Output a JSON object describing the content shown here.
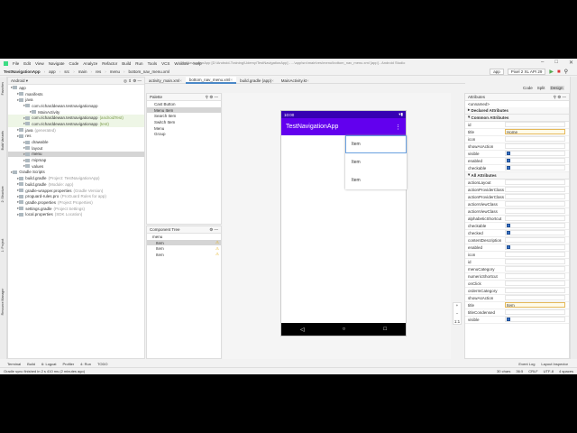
{
  "window": {
    "title": "TestNavigationApp [D:\\Android-Training\\Udemy\\TestNavigationApp] - ...\\app\\src\\main\\res\\menu\\bottom_nav_menu.xml [app] - Android Studio"
  },
  "menu": [
    "File",
    "Edit",
    "View",
    "Navigate",
    "Code",
    "Analyze",
    "Refactor",
    "Build",
    "Run",
    "Tools",
    "VCS",
    "Window",
    "Help"
  ],
  "breadcrumb": [
    "TestNavigationApp",
    "app",
    "src",
    "main",
    "res",
    "menu",
    "bottom_nav_menu.xml"
  ],
  "toolbar": {
    "run_config": "app",
    "device": "Pixel 2 XL API 29"
  },
  "project": {
    "view": "Android",
    "tree": [
      {
        "label": "app",
        "indent": 0
      },
      {
        "label": "manifests",
        "indent": 1
      },
      {
        "label": "java",
        "indent": 1
      },
      {
        "label": "com.richarddewan.testnavigationapp",
        "indent": 2
      },
      {
        "label": "MainActivity",
        "indent": 3
      },
      {
        "label": "com.richarddewan.testnavigationapp",
        "note": "(androidTest)",
        "indent": 2,
        "green": true
      },
      {
        "label": "com.richarddewan.testnavigationapp",
        "note": "(test)",
        "indent": 2,
        "green": true
      },
      {
        "label": "java",
        "note": "(generated)",
        "indent": 1
      },
      {
        "label": "res",
        "indent": 1
      },
      {
        "label": "drawable",
        "indent": 2
      },
      {
        "label": "layout",
        "indent": 2
      },
      {
        "label": "menu",
        "indent": 2,
        "selected": true
      },
      {
        "label": "mipmap",
        "indent": 2
      },
      {
        "label": "values",
        "indent": 2
      },
      {
        "label": "Gradle Scripts",
        "indent": 0
      },
      {
        "label": "build.gradle",
        "note": "(Project: TestNavigationApp)",
        "indent": 1
      },
      {
        "label": "build.gradle",
        "note": "(Module: app)",
        "indent": 1
      },
      {
        "label": "gradle-wrapper.properties",
        "note": "(Gradle Version)",
        "indent": 1
      },
      {
        "label": "proguard-rules.pro",
        "note": "(ProGuard Rules for app)",
        "indent": 1
      },
      {
        "label": "gradle.properties",
        "note": "(Project Properties)",
        "indent": 1
      },
      {
        "label": "settings.gradle",
        "note": "(Project Settings)",
        "indent": 1
      },
      {
        "label": "local.properties",
        "note": "(SDK Location)",
        "indent": 1
      }
    ]
  },
  "side_left": [
    "Resource Manager",
    "1: Project",
    "2: Structure",
    "Build Variants",
    "Favorites"
  ],
  "editor_tabs": [
    "activity_main.xml",
    "bottom_nav_menu.xml",
    "build.gradle (app)",
    "MainActivity.kt"
  ],
  "view_modes": [
    "Code",
    "Split",
    "Design"
  ],
  "palette": {
    "title": "Palette",
    "items": [
      "Cast Button",
      "Menu Item",
      "Search Item",
      "Switch Item",
      "Menu",
      "Group"
    ]
  },
  "component_tree": {
    "title": "Component Tree",
    "root": "menu",
    "items": [
      "Item",
      "Item",
      "Item"
    ]
  },
  "phone": {
    "time": "10:00",
    "app_title": "TestNavigationApp",
    "items": [
      "Item",
      "Item",
      "Item"
    ],
    "appbar_color": "#6200ee",
    "status_color": "#3700b3"
  },
  "zoom_controls": [
    "+",
    "−",
    "1:1"
  ],
  "attributes": {
    "title": "Attributes",
    "component": "<unnamed>",
    "declared": "Declared Attributes",
    "common": "Common Attributes",
    "common_rows": [
      {
        "k": "id",
        "v": ""
      },
      {
        "k": "title",
        "v": "Home"
      },
      {
        "k": "icon",
        "v": ""
      },
      {
        "k": "showAsAction",
        "v": ""
      },
      {
        "k": "visible",
        "v": ""
      },
      {
        "k": "enabled",
        "v": ""
      },
      {
        "k": "checkable",
        "v": ""
      }
    ],
    "all": "All Attributes",
    "all_rows": [
      {
        "k": "actionLayout",
        "v": ""
      },
      {
        "k": "actionProviderClass",
        "v": ""
      },
      {
        "k": "actionProviderClass",
        "v": ""
      },
      {
        "k": "actionViewClass",
        "v": ""
      },
      {
        "k": "actionViewClass",
        "v": ""
      },
      {
        "k": "alphabeticShortcut",
        "v": ""
      },
      {
        "k": "checkable",
        "v": ""
      },
      {
        "k": "checked",
        "v": ""
      },
      {
        "k": "contentDescription",
        "v": ""
      },
      {
        "k": "enabled",
        "v": ""
      },
      {
        "k": "icon",
        "v": ""
      },
      {
        "k": "id",
        "v": ""
      },
      {
        "k": "menuCategory",
        "v": ""
      },
      {
        "k": "numericShortcut",
        "v": ""
      },
      {
        "k": "onClick",
        "v": ""
      },
      {
        "k": "orderInCategory",
        "v": ""
      },
      {
        "k": "showAsAction",
        "v": ""
      },
      {
        "k": "title",
        "v": "Item"
      },
      {
        "k": "titleCondensed",
        "v": ""
      },
      {
        "k": "visible",
        "v": ""
      }
    ]
  },
  "bottom_tools": [
    "Terminal",
    "Build",
    "6: Logcat",
    "Profiler",
    "4: Run",
    "TODO"
  ],
  "bottom_right_tools": [
    "Event Log",
    "Layout Inspector"
  ],
  "status": {
    "message": "Gradle sync finished in 2 s 410 ms (2 minutes ago)",
    "chars": "30 chars",
    "pos": "36:5",
    "eol": "CRLF",
    "enc": "UTF-8",
    "indent": "4 spaces"
  }
}
